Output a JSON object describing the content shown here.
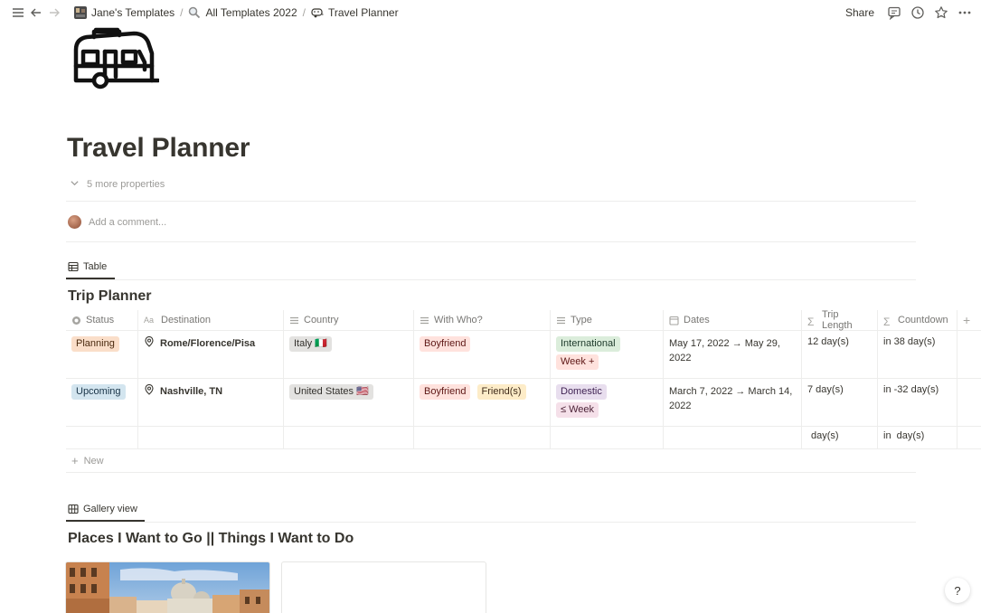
{
  "breadcrumbs": [
    {
      "label": "Jane's Templates",
      "icon": "workspace-avatar-icon"
    },
    {
      "label": "All Templates 2022",
      "icon": "magnifier-icon"
    },
    {
      "label": "Travel Planner",
      "icon": "camper-icon"
    }
  ],
  "topbar": {
    "share_label": "Share"
  },
  "page": {
    "title": "Travel Planner",
    "more_properties": "5 more properties",
    "comment_placeholder": "Add a comment..."
  },
  "table_view": {
    "tab_label": "Table",
    "db_title": "Trip Planner",
    "columns": [
      "Status",
      "Destination",
      "Country",
      "With Who?",
      "Type",
      "Dates",
      "Trip Length",
      "Countdown"
    ],
    "rows": [
      {
        "status": "Planning",
        "destination": "Rome/Florence/Pisa",
        "country": "Italy 🇮🇹",
        "with": [
          "Boyfriend"
        ],
        "type": [
          "International",
          "Week +"
        ],
        "dates": "May 17, 2022 → May 29, 2022",
        "trip_length": "12 day(s)",
        "countdown": "in 38 day(s)"
      },
      {
        "status": "Upcoming",
        "destination": "Nashville, TN",
        "country": "United States 🇺🇸",
        "with": [
          "Boyfriend",
          "Friend(s)"
        ],
        "type": [
          "Domestic",
          "≤ Week"
        ],
        "dates": "March 7, 2022 → March 14, 2022",
        "trip_length": "7 day(s)",
        "countdown": "in -32 day(s)"
      }
    ],
    "empty_row": {
      "trip_length": "day(s)",
      "countdown": "in  day(s)"
    },
    "new_label": "New"
  },
  "gallery_view": {
    "tab_label": "Gallery view",
    "db_title": "Places I Want to Go || Things I Want to Do"
  },
  "help_label": "?",
  "colors": {
    "planning_bg": "#fadec9",
    "planning_fg": "#49290e",
    "upcoming_bg": "#d3e5ef",
    "upcoming_fg": "#183347",
    "gray_bg": "#e3e2e0",
    "gray_fg": "#32302c",
    "red_bg": "#ffe2dd",
    "red_fg": "#5d1715",
    "orange_bg": "#fdecc8",
    "orange_fg": "#402c1b",
    "green_bg": "#dbeddb",
    "green_fg": "#1c3829",
    "purple_bg": "#e8deee",
    "purple_fg": "#412454",
    "pink_bg": "#f5e0e9",
    "pink_fg": "#4c2337"
  }
}
